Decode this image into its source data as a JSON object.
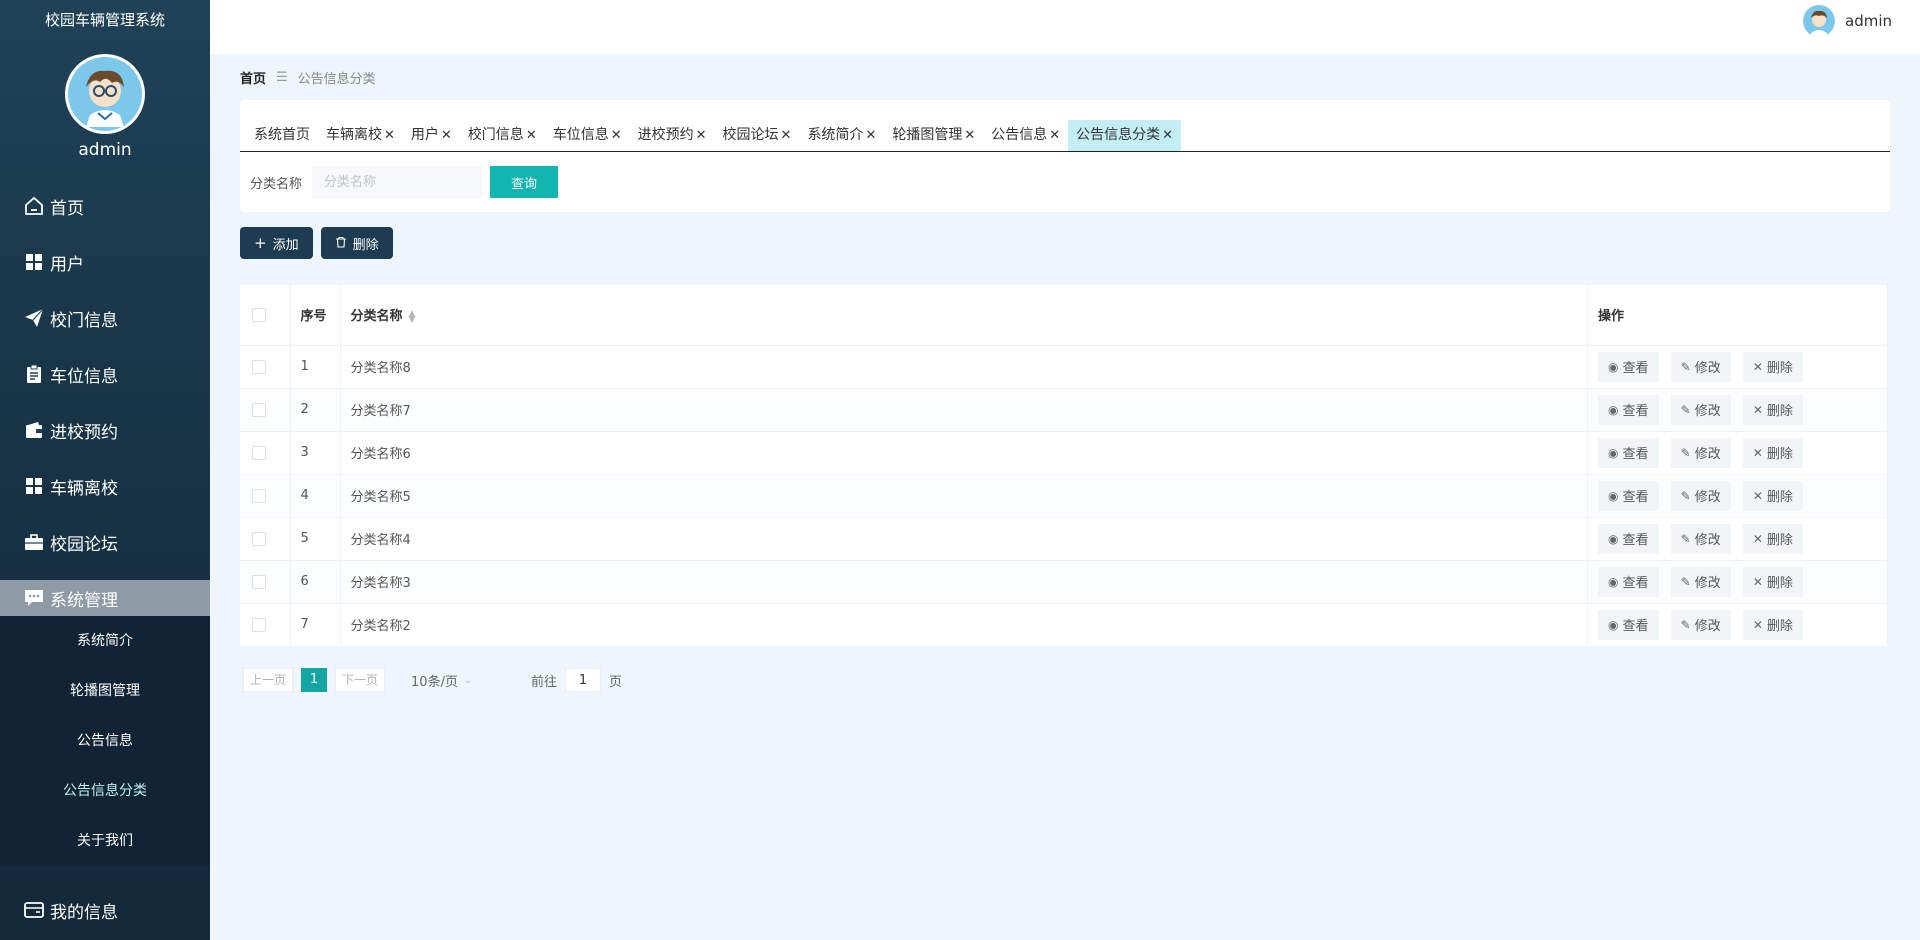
{
  "sidebar": {
    "system_title": "校园车辆管理系统",
    "admin_name": "admin",
    "menu": [
      {
        "label": "首页",
        "icon": "home-icon"
      },
      {
        "label": "用户",
        "icon": "grid-icon"
      },
      {
        "label": "校门信息",
        "icon": "paper-plane-icon"
      },
      {
        "label": "车位信息",
        "icon": "clipboard-icon"
      },
      {
        "label": "进校预约",
        "icon": "wallet-icon"
      },
      {
        "label": "车辆离校",
        "icon": "grid-icon"
      },
      {
        "label": "校园论坛",
        "icon": "briefcase-icon"
      }
    ],
    "open_menu": {
      "label": "系统管理",
      "icon": "chat-icon"
    },
    "submenu": [
      "系统简介",
      "轮播图管理",
      "公告信息",
      "公告信息分类",
      "关于我们"
    ],
    "active_submenu": "公告信息分类",
    "bottom_menu": {
      "label": "我的信息",
      "icon": "card-icon"
    }
  },
  "header": {
    "username": "admin"
  },
  "breadcrumb": {
    "home": "首页",
    "current": "公告信息分类"
  },
  "tabs": [
    {
      "label": "系统首页",
      "closable": false
    },
    {
      "label": "车辆离校",
      "closable": true
    },
    {
      "label": "用户",
      "closable": true
    },
    {
      "label": "校门信息",
      "closable": true
    },
    {
      "label": "车位信息",
      "closable": true
    },
    {
      "label": "进校预约",
      "closable": true
    },
    {
      "label": "校园论坛",
      "closable": true
    },
    {
      "label": "系统简介",
      "closable": true
    },
    {
      "label": "轮播图管理",
      "closable": true
    },
    {
      "label": "公告信息",
      "closable": true
    },
    {
      "label": "公告信息分类",
      "closable": true,
      "active": true
    }
  ],
  "search": {
    "label": "分类名称",
    "placeholder": "分类名称",
    "value": "",
    "button": "查询"
  },
  "actions": {
    "add": "添加",
    "delete": "删除"
  },
  "table": {
    "headers": {
      "index": "序号",
      "name": "分类名称",
      "ops": "操作"
    },
    "rows": [
      {
        "index": "1",
        "name": "分类名称8"
      },
      {
        "index": "2",
        "name": "分类名称7"
      },
      {
        "index": "3",
        "name": "分类名称6"
      },
      {
        "index": "4",
        "name": "分类名称5"
      },
      {
        "index": "5",
        "name": "分类名称4"
      },
      {
        "index": "6",
        "name": "分类名称3"
      },
      {
        "index": "7",
        "name": "分类名称2"
      }
    ],
    "row_ops": {
      "view": "查看",
      "edit": "修改",
      "delete": "删除"
    }
  },
  "pagination": {
    "prev": "上一页",
    "current": "1",
    "next": "下一页",
    "page_size": "10条/页",
    "goto_label": "前往",
    "goto_value": "1",
    "goto_unit": "页"
  },
  "colors": {
    "sidebar_bg": "#1f4257",
    "accent": "#13b5b1",
    "action_btn": "#1d3c51",
    "active_tab": "#c4eef6"
  }
}
